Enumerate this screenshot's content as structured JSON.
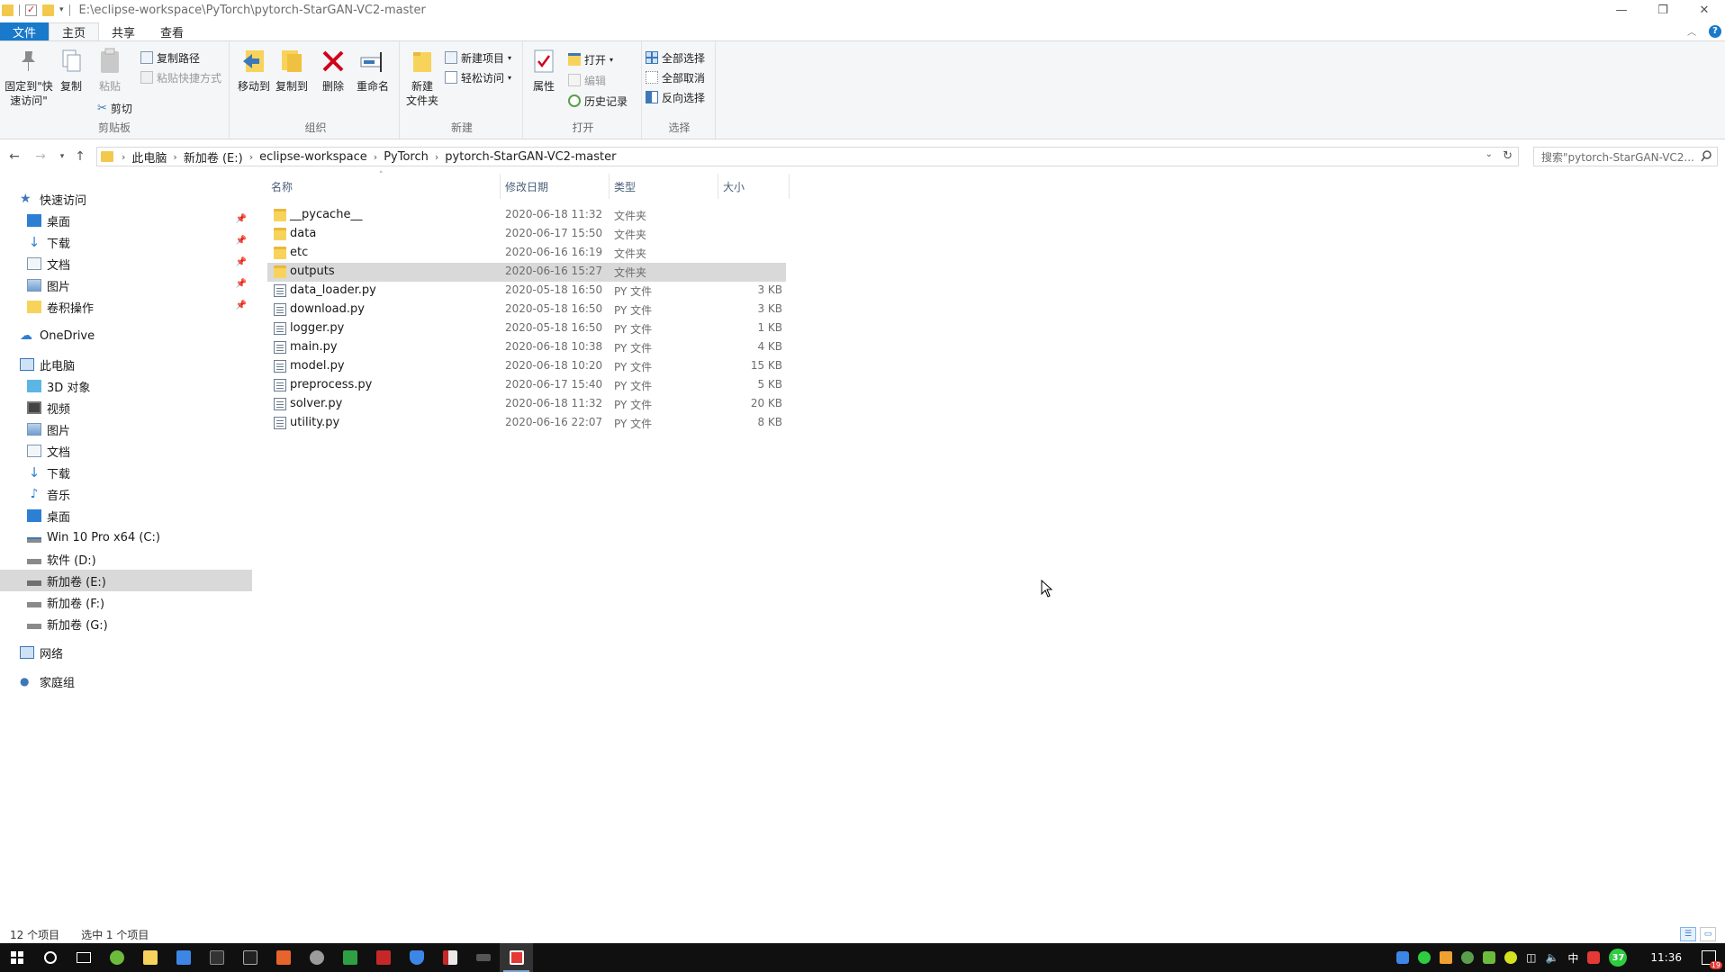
{
  "window": {
    "title_path": "E:\\eclipse-workspace\\PyTorch\\pytorch-StarGAN-VC2-master",
    "minimize_icon": "minimize-icon",
    "maximize_icon": "restore-icon",
    "close_icon": "close-icon"
  },
  "ribbon_tabs": [
    {
      "label": "文件"
    },
    {
      "label": "主页"
    },
    {
      "label": "共享"
    },
    {
      "label": "查看"
    }
  ],
  "ribbon": {
    "clipboard": {
      "group_label": "剪贴板",
      "pin_label": "固定到\"快\n速访问\"",
      "copy_label": "复制",
      "paste_label": "粘贴",
      "copy_path_label": "复制路径",
      "paste_shortcut_label": "粘贴快捷方式",
      "cut_label": "剪切"
    },
    "organize": {
      "group_label": "组织",
      "move_to_label": "移动到",
      "copy_to_label": "复制到",
      "delete_label": "删除",
      "rename_label": "重命名"
    },
    "new": {
      "group_label": "新建",
      "new_folder_label": "新建\n文件夹",
      "new_item_label": "新建项目",
      "easy_access_label": "轻松访问"
    },
    "open": {
      "group_label": "打开",
      "properties_label": "属性",
      "open_label": "打开",
      "edit_label": "编辑",
      "history_label": "历史记录"
    },
    "select": {
      "group_label": "选择",
      "select_all_label": "全部选择",
      "select_none_label": "全部取消",
      "invert_label": "反向选择"
    }
  },
  "address": {
    "crumbs": [
      "此电脑",
      "新加卷 (E:)",
      "eclipse-workspace",
      "PyTorch",
      "pytorch-StarGAN-VC2-master"
    ],
    "search_placeholder": "搜索\"pytorch-StarGAN-VC2...",
    "back_icon": "back-arrow-icon",
    "forward_icon": "forward-arrow-icon",
    "up_icon": "up-arrow-icon",
    "refresh_icon": "refresh-icon"
  },
  "nav_pane": {
    "quick_access": "快速访问",
    "quick_items": [
      {
        "label": "桌面",
        "icon": "desktop-icon",
        "pinned": true
      },
      {
        "label": "下载",
        "icon": "download-icon",
        "pinned": true
      },
      {
        "label": "文档",
        "icon": "documents-icon",
        "pinned": true
      },
      {
        "label": "图片",
        "icon": "pictures-icon",
        "pinned": true
      },
      {
        "label": "卷积操作",
        "icon": "folder-icon",
        "pinned": true
      }
    ],
    "onedrive": "OneDrive",
    "this_pc": "此电脑",
    "pc_items": [
      {
        "label": "3D 对象",
        "icon": "3d-objects-icon"
      },
      {
        "label": "视频",
        "icon": "videos-icon"
      },
      {
        "label": "图片",
        "icon": "pictures-icon"
      },
      {
        "label": "文档",
        "icon": "documents-icon"
      },
      {
        "label": "下载",
        "icon": "download-icon"
      },
      {
        "label": "音乐",
        "icon": "music-icon"
      },
      {
        "label": "桌面",
        "icon": "desktop-icon"
      },
      {
        "label": "Win 10 Pro x64 (C:)",
        "icon": "drive-icon"
      },
      {
        "label": "软件 (D:)",
        "icon": "drive-icon"
      },
      {
        "label": "新加卷 (E:)",
        "icon": "drive-icon",
        "selected": true
      },
      {
        "label": "新加卷 (F:)",
        "icon": "drive-icon"
      },
      {
        "label": "新加卷 (G:)",
        "icon": "drive-icon"
      }
    ],
    "network": "网络",
    "homegroup": "家庭组"
  },
  "file_list": {
    "columns": {
      "name": "名称",
      "date": "修改日期",
      "type": "类型",
      "size": "大小"
    },
    "rows": [
      {
        "name": "__pycache__",
        "date": "2020-06-18 11:32",
        "type": "文件夹",
        "size": "",
        "kind": "folder"
      },
      {
        "name": "data",
        "date": "2020-06-17 15:50",
        "type": "文件夹",
        "size": "",
        "kind": "folder"
      },
      {
        "name": "etc",
        "date": "2020-06-16 16:19",
        "type": "文件夹",
        "size": "",
        "kind": "folder"
      },
      {
        "name": "outputs",
        "date": "2020-06-16 15:27",
        "type": "文件夹",
        "size": "",
        "kind": "folder",
        "selected": true
      },
      {
        "name": "data_loader.py",
        "date": "2020-05-18 16:50",
        "type": "PY 文件",
        "size": "3 KB",
        "kind": "py"
      },
      {
        "name": "download.py",
        "date": "2020-05-18 16:50",
        "type": "PY 文件",
        "size": "3 KB",
        "kind": "py"
      },
      {
        "name": "logger.py",
        "date": "2020-05-18 16:50",
        "type": "PY 文件",
        "size": "1 KB",
        "kind": "py"
      },
      {
        "name": "main.py",
        "date": "2020-06-18 10:38",
        "type": "PY 文件",
        "size": "4 KB",
        "kind": "py"
      },
      {
        "name": "model.py",
        "date": "2020-06-18 10:20",
        "type": "PY 文件",
        "size": "15 KB",
        "kind": "py"
      },
      {
        "name": "preprocess.py",
        "date": "2020-06-17 15:40",
        "type": "PY 文件",
        "size": "5 KB",
        "kind": "py"
      },
      {
        "name": "solver.py",
        "date": "2020-06-18 11:32",
        "type": "PY 文件",
        "size": "20 KB",
        "kind": "py"
      },
      {
        "name": "utility.py",
        "date": "2020-06-16 22:07",
        "type": "PY 文件",
        "size": "8 KB",
        "kind": "py"
      }
    ]
  },
  "status": {
    "item_count": "12 个项目",
    "selected_count": "选中 1 个项目"
  },
  "taskbar": {
    "clock": "11:36",
    "ime": "中",
    "badge_count": "37",
    "notification_count": "19",
    "colors": {
      "accent": "#1979ca",
      "selected_row": "#d9d9d9",
      "taskbar": "#101010"
    }
  }
}
